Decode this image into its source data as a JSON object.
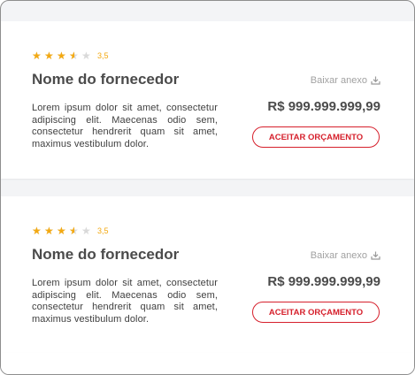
{
  "cards": [
    {
      "rating": 3.5,
      "rating_label": "3,5",
      "supplier_name": "Nome do fornecedor",
      "description": "Lorem ipsum dolor sit amet, consectetur adipiscing elit. Maecenas odio sem, consectetur hendrerit quam sit amet, maximus vestibulum dolor.",
      "download_label": "Baixar anexo",
      "price": "R$ 999.999.999,99",
      "accept_label": "ACEITAR ORÇAMENTO"
    },
    {
      "rating": 3.5,
      "rating_label": "3,5",
      "supplier_name": "Nome do fornecedor",
      "description": "Lorem ipsum dolor sit amet, consectetur adipiscing elit. Maecenas odio sem, consectetur hendrerit quam sit amet, maximus vestibulum dolor.",
      "download_label": "Baixar anexo",
      "price": "R$ 999.999.999,99",
      "accept_label": "ACEITAR ORÇAMENTO"
    }
  ],
  "colors": {
    "star": "#f3a912",
    "star_empty": "#d9d9d9",
    "accent": "#d6202c",
    "text_dark": "#4b4b4b",
    "text_muted": "#a1a1a1"
  },
  "icons": [
    "star-icon",
    "download-icon"
  ]
}
